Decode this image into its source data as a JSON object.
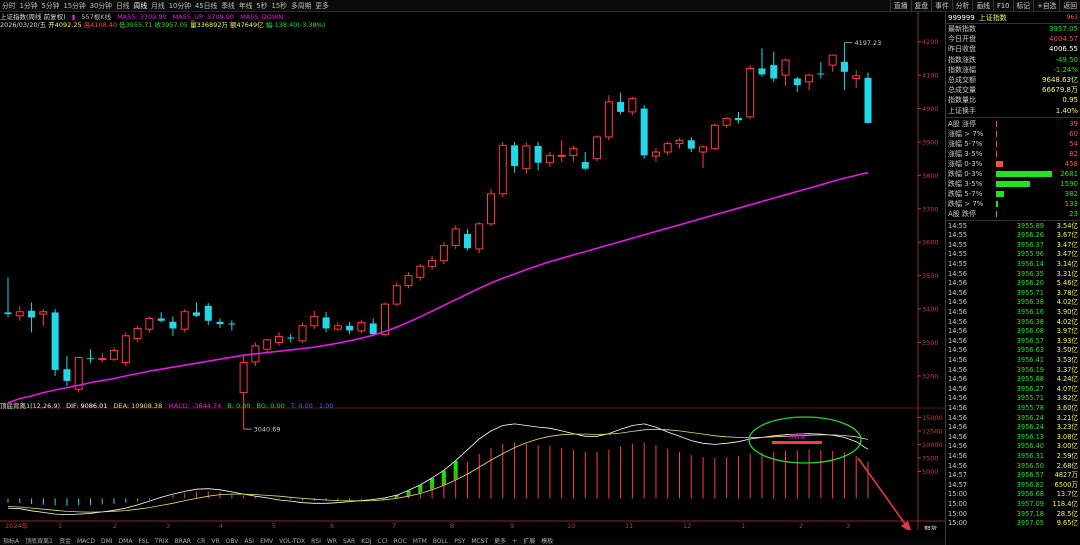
{
  "top_bar": {
    "periods": [
      "分时",
      "1分钟",
      "5分钟",
      "15分钟",
      "30分钟",
      "日线",
      "周线",
      "月线",
      "10分钟",
      "45日线",
      "季线",
      "年线",
      "5秒",
      "15秒",
      "多周期",
      "更多"
    ],
    "active_period": 6,
    "tools": [
      "直播",
      "复盘",
      "事件",
      "分析",
      "画线",
      "F10",
      "标记",
      "+自选",
      "返回"
    ]
  },
  "info_line": {
    "title": "上证指数(周线 前复权)",
    "cnt_icon": "▮",
    "count": "557根K线",
    "ma5": "MA55: 3709.90",
    "ma5_up": "MA55_UP: 3709.90",
    "ma5_down": "MA55_DOWN: -"
  },
  "bar_info": {
    "date": "2026/03/20/五",
    "open": "开4092.25",
    "high": "高4108.40",
    "low": "低3955.71",
    "close": "收3957.05",
    "vol": "量336892万",
    "amount": "额47649亿",
    "change": "幅-138.40(-3.38%)"
  },
  "indicator_line": {
    "name": "顶底背离1(12,26,9)",
    "dif": "DIF: 9086.01",
    "dea": "DEA: 10908.38",
    "macd": "MACD: -3644.74",
    "b": "B: 0.00",
    "bg": "BG: 0.00",
    "t": "T: 0.00",
    "extra": "1.00"
  },
  "bottom_tabs": [
    "指标A",
    "顶底背离1",
    "资金",
    "MACD",
    "DMI",
    "DMA",
    "FSL",
    "TRIX",
    "BRAR",
    "CR",
    "VR",
    "OBV",
    "ASI",
    "EMV",
    "VOL-TDX",
    "RSI",
    "WR",
    "SAR",
    "KDJ",
    "CCI",
    "ROC",
    "MTM",
    "BOLL",
    "PSY",
    "MCST",
    "更多",
    "+",
    "扩展",
    "模板"
  ],
  "colors": {
    "up": "#ff3b3b",
    "down": "#22d8e6",
    "ma": "#e21ae2",
    "dif": "#ffffff",
    "dea": "#e8e06a",
    "hist_green": "#00f000",
    "hist_red": "#ff3b3b",
    "axis": "#c04040",
    "label_pos": "#ff4a4a",
    "label_neg": "#23e123",
    "yellow": "#f5f561"
  },
  "chart_data": {
    "type": "candlestick",
    "price_axis": {
      "ticks": [
        3200,
        3300,
        3400,
        3500,
        3600,
        3700,
        3800,
        3900,
        4000,
        4100,
        4200
      ],
      "range": [
        3110,
        4265
      ]
    },
    "indicator_axis": {
      "ticks": [
        5000,
        7500,
        10000,
        12500,
        15000
      ],
      "range": [
        -4000,
        16000
      ]
    },
    "x_labels": [
      "2024年",
      "1",
      "2",
      "3",
      "4",
      "5",
      "6",
      "7",
      "8",
      "9",
      "10",
      "11",
      "12",
      "1",
      "2",
      "3"
    ],
    "candles": [
      {
        "o": 3390,
        "h": 3495,
        "l": 3375,
        "c": 3385
      },
      {
        "o": 3380,
        "h": 3410,
        "l": 3365,
        "c": 3392
      },
      {
        "o": 3395,
        "h": 3420,
        "l": 3330,
        "c": 3375
      },
      {
        "o": 3385,
        "h": 3400,
        "l": 3350,
        "c": 3392
      },
      {
        "o": 3390,
        "h": 3400,
        "l": 3200,
        "c": 3218
      },
      {
        "o": 3220,
        "h": 3260,
        "l": 3170,
        "c": 3185
      },
      {
        "o": 3160,
        "h": 3255,
        "l": 3150,
        "c": 3255
      },
      {
        "o": 3253,
        "h": 3280,
        "l": 3238,
        "c": 3250
      },
      {
        "o": 3252,
        "h": 3268,
        "l": 3240,
        "c": 3252
      },
      {
        "o": 3250,
        "h": 3285,
        "l": 3244,
        "c": 3276
      },
      {
        "o": 3240,
        "h": 3330,
        "l": 3228,
        "c": 3320
      },
      {
        "o": 3312,
        "h": 3350,
        "l": 3300,
        "c": 3342
      },
      {
        "o": 3340,
        "h": 3378,
        "l": 3330,
        "c": 3372
      },
      {
        "o": 3372,
        "h": 3390,
        "l": 3360,
        "c": 3365
      },
      {
        "o": 3362,
        "h": 3378,
        "l": 3320,
        "c": 3342
      },
      {
        "o": 3340,
        "h": 3400,
        "l": 3330,
        "c": 3392
      },
      {
        "o": 3390,
        "h": 3420,
        "l": 3376,
        "c": 3380
      },
      {
        "o": 3410,
        "h": 3418,
        "l": 3352,
        "c": 3365
      },
      {
        "o": 3362,
        "h": 3372,
        "l": 3344,
        "c": 3355
      },
      {
        "o": 3357,
        "h": 3366,
        "l": 3335,
        "c": 3354
      },
      {
        "o": 3150,
        "h": 3260,
        "l": 3041,
        "c": 3240
      },
      {
        "o": 3242,
        "h": 3300,
        "l": 3230,
        "c": 3290
      },
      {
        "o": 3280,
        "h": 3310,
        "l": 3268,
        "c": 3308
      },
      {
        "o": 3300,
        "h": 3330,
        "l": 3290,
        "c": 3318
      },
      {
        "o": 3315,
        "h": 3325,
        "l": 3300,
        "c": 3312
      },
      {
        "o": 3305,
        "h": 3360,
        "l": 3298,
        "c": 3350
      },
      {
        "o": 3350,
        "h": 3395,
        "l": 3340,
        "c": 3378
      },
      {
        "o": 3375,
        "h": 3392,
        "l": 3330,
        "c": 3342
      },
      {
        "o": 3340,
        "h": 3360,
        "l": 3335,
        "c": 3350
      },
      {
        "o": 3350,
        "h": 3362,
        "l": 3325,
        "c": 3336
      },
      {
        "o": 3335,
        "h": 3368,
        "l": 3328,
        "c": 3360
      },
      {
        "o": 3357,
        "h": 3372,
        "l": 3318,
        "c": 3325
      },
      {
        "o": 3324,
        "h": 3420,
        "l": 3318,
        "c": 3415
      },
      {
        "o": 3415,
        "h": 3480,
        "l": 3408,
        "c": 3470
      },
      {
        "o": 3470,
        "h": 3510,
        "l": 3462,
        "c": 3500
      },
      {
        "o": 3495,
        "h": 3535,
        "l": 3485,
        "c": 3528
      },
      {
        "o": 3528,
        "h": 3560,
        "l": 3518,
        "c": 3545
      },
      {
        "o": 3545,
        "h": 3600,
        "l": 3535,
        "c": 3590
      },
      {
        "o": 3590,
        "h": 3650,
        "l": 3580,
        "c": 3640
      },
      {
        "o": 3625,
        "h": 3640,
        "l": 3575,
        "c": 3582
      },
      {
        "o": 3580,
        "h": 3660,
        "l": 3568,
        "c": 3655
      },
      {
        "o": 3655,
        "h": 3760,
        "l": 3648,
        "c": 3745
      },
      {
        "o": 3745,
        "h": 3900,
        "l": 3735,
        "c": 3890
      },
      {
        "o": 3890,
        "h": 3900,
        "l": 3808,
        "c": 3828
      },
      {
        "o": 3820,
        "h": 3898,
        "l": 3805,
        "c": 3888
      },
      {
        "o": 3888,
        "h": 3900,
        "l": 3815,
        "c": 3838
      },
      {
        "o": 3838,
        "h": 3870,
        "l": 3825,
        "c": 3860
      },
      {
        "o": 3858,
        "h": 3905,
        "l": 3840,
        "c": 3860
      },
      {
        "o": 3860,
        "h": 3888,
        "l": 3842,
        "c": 3880
      },
      {
        "o": 3840,
        "h": 3870,
        "l": 3815,
        "c": 3820
      },
      {
        "o": 3850,
        "h": 3920,
        "l": 3842,
        "c": 3915
      },
      {
        "o": 3915,
        "h": 4040,
        "l": 3905,
        "c": 4020
      },
      {
        "o": 4020,
        "h": 4048,
        "l": 3982,
        "c": 3990
      },
      {
        "o": 3990,
        "h": 4035,
        "l": 3980,
        "c": 4030
      },
      {
        "o": 4000,
        "h": 4010,
        "l": 3850,
        "c": 3860
      },
      {
        "o": 3858,
        "h": 3882,
        "l": 3840,
        "c": 3870
      },
      {
        "o": 3870,
        "h": 3902,
        "l": 3860,
        "c": 3895
      },
      {
        "o": 3895,
        "h": 3912,
        "l": 3880,
        "c": 3905
      },
      {
        "o": 3905,
        "h": 3915,
        "l": 3870,
        "c": 3880
      },
      {
        "o": 3870,
        "h": 3890,
        "l": 3822,
        "c": 3885
      },
      {
        "o": 3880,
        "h": 3955,
        "l": 3875,
        "c": 3950
      },
      {
        "o": 3950,
        "h": 3975,
        "l": 3942,
        "c": 3970
      },
      {
        "o": 3972,
        "h": 3990,
        "l": 3955,
        "c": 3965
      },
      {
        "o": 3975,
        "h": 4130,
        "l": 3968,
        "c": 4120
      },
      {
        "o": 4120,
        "h": 4180,
        "l": 4095,
        "c": 4102
      },
      {
        "o": 4130,
        "h": 4170,
        "l": 4080,
        "c": 4090
      },
      {
        "o": 4100,
        "h": 4150,
        "l": 4068,
        "c": 4145
      },
      {
        "o": 4090,
        "h": 4095,
        "l": 4050,
        "c": 4070
      },
      {
        "o": 4080,
        "h": 4105,
        "l": 4055,
        "c": 4100
      },
      {
        "o": 4105,
        "h": 4140,
        "l": 4090,
        "c": 4102
      },
      {
        "o": 4130,
        "h": 4162,
        "l": 4110,
        "c": 4160
      },
      {
        "o": 4140,
        "h": 4197,
        "l": 4055,
        "c": 4110
      },
      {
        "o": 4090,
        "h": 4115,
        "l": 4062,
        "c": 4098
      },
      {
        "o": 4092,
        "h": 4108,
        "l": 3955,
        "c": 3957
      }
    ],
    "ma55": [
      3120,
      3132,
      3140,
      3150,
      3158,
      3165,
      3172,
      3180,
      3186,
      3192,
      3200,
      3207,
      3214,
      3220,
      3226,
      3232,
      3238,
      3244,
      3250,
      3256,
      3262,
      3266,
      3270,
      3274,
      3278,
      3282,
      3286,
      3292,
      3298,
      3305,
      3313,
      3322,
      3333,
      3346,
      3361,
      3377,
      3394,
      3411,
      3428,
      3445,
      3462,
      3478,
      3492,
      3505,
      3518,
      3530,
      3542,
      3552,
      3562,
      3572,
      3582,
      3592,
      3602,
      3612,
      3622,
      3632,
      3642,
      3652,
      3662,
      3672,
      3682,
      3692,
      3702,
      3712,
      3722,
      3732,
      3742,
      3752,
      3762,
      3772,
      3782,
      3792,
      3800,
      3808
    ],
    "dif": [
      -1800,
      -1900,
      -2300,
      -2600,
      -2900,
      -3000,
      -2900,
      -2800,
      -2500,
      -2200,
      -1800,
      -1200,
      -500,
      200,
      800,
      1300,
      1700,
      1800,
      1600,
      1200,
      800,
      400,
      100,
      -300,
      -500,
      -800,
      -900,
      -900,
      -800,
      -600,
      -400,
      -200,
      100,
      600,
      1500,
      2500,
      3800,
      5200,
      7000,
      9000,
      11000,
      12500,
      13500,
      13800,
      13500,
      13200,
      13000,
      12500,
      12000,
      11500,
      11500,
      12000,
      12800,
      13500,
      13800,
      13200,
      12300,
      11500,
      10700,
      10200,
      10000,
      10200,
      10500,
      11000,
      11300,
      11600,
      11800,
      11900,
      12000,
      11900,
      11700,
      11300,
      10500,
      9100
    ],
    "dea": [
      -1500,
      -1600,
      -1800,
      -2000,
      -2200,
      -2400,
      -2500,
      -2550,
      -2500,
      -2400,
      -2250,
      -2000,
      -1700,
      -1300,
      -900,
      -400,
      0,
      400,
      700,
      800,
      800,
      700,
      550,
      400,
      200,
      0,
      -150,
      -300,
      -400,
      -450,
      -450,
      -400,
      -250,
      0,
      400,
      900,
      1600,
      2400,
      3400,
      4500,
      5800,
      7100,
      8300,
      9400,
      10300,
      11000,
      11500,
      11800,
      11900,
      11900,
      11850,
      11900,
      12100,
      12400,
      12700,
      12800,
      12700,
      12500,
      12200,
      11900,
      11600,
      11400,
      11300,
      11300,
      11300,
      11400,
      11500,
      11600,
      11700,
      11750,
      11750,
      11650,
      11400,
      10900
    ],
    "annotations": {
      "high_label": "4197.23",
      "low_label": "3040.69",
      "ellipse_text": "顶背离"
    }
  },
  "quote": {
    "code": "999999",
    "name": "上证指数",
    "tag": "963",
    "rows": [
      {
        "label": "最新指数",
        "value": "3957.05",
        "color": "#23e123"
      },
      {
        "label": "今日开盘",
        "value": "4004.57",
        "color": "#ff4a4a"
      },
      {
        "label": "昨日收盘",
        "value": "4006.55",
        "color": "#ffffff"
      },
      {
        "label": "指数涨跌",
        "value": "-49.50",
        "color": "#23e123"
      },
      {
        "label": "指数涨幅",
        "value": "-1.24%",
        "color": "#23e123"
      },
      {
        "label": "总成交额",
        "value": "9648.63亿",
        "color": "#f5f561"
      },
      {
        "label": "总成交量",
        "value": "66679.8万",
        "color": "#f5f561"
      },
      {
        "label": "指数量比",
        "value": "0.95",
        "color": "#f5f561"
      },
      {
        "label": "上证换手",
        "value": "1.40%",
        "color": "#f5f561"
      }
    ],
    "dist": [
      {
        "label": "A股 涨停",
        "count": "39",
        "color": "#ff4a4a",
        "pct": 0
      },
      {
        "label": "涨幅 > 7%",
        "count": "60",
        "color": "#ff4a4a",
        "pct": 1
      },
      {
        "label": "涨幅 5-7%",
        "count": "54",
        "color": "#ff4a4a",
        "pct": 1
      },
      {
        "label": "涨幅 3-5%",
        "count": "82",
        "color": "#ff4a4a",
        "pct": 2
      },
      {
        "label": "涨幅 0-3%",
        "count": "458",
        "color": "#ff4a4a",
        "pct": 12
      },
      {
        "label": "跌幅 0-3%",
        "count": "2681",
        "color": "#23e123",
        "pct": 100
      },
      {
        "label": "跌幅 3-5%",
        "count": "1590",
        "color": "#23e123",
        "pct": 60
      },
      {
        "label": "跌幅 5-7%",
        "count": "382",
        "color": "#23e123",
        "pct": 14
      },
      {
        "label": "跌幅 > 7%",
        "count": "133",
        "color": "#23e123",
        "pct": 4
      },
      {
        "label": "A股 跌停",
        "count": "23",
        "color": "#23e123",
        "pct": 0
      }
    ],
    "ticks": [
      {
        "t": "14:55",
        "p": "3955.89",
        "a": "3.54亿"
      },
      {
        "t": "14:55",
        "p": "3956.26",
        "a": "3.67亿"
      },
      {
        "t": "14:55",
        "p": "3956.37",
        "a": "3.47亿"
      },
      {
        "t": "14:55",
        "p": "3955.96",
        "a": "3.47亿"
      },
      {
        "t": "14:55",
        "p": "3956.14",
        "a": "3.14亿"
      },
      {
        "t": "14:56",
        "p": "3956.35",
        "a": "3.31亿"
      },
      {
        "t": "14:56",
        "p": "3956.20",
        "a": "5.46亿"
      },
      {
        "t": "14:56",
        "p": "3955.71",
        "a": "3.78亿"
      },
      {
        "t": "14:56",
        "p": "3956.38",
        "a": "4.02亿"
      },
      {
        "t": "14:56",
        "p": "3956.16",
        "a": "3.90亿"
      },
      {
        "t": "14:56",
        "p": "3956.38",
        "a": "4.02亿"
      },
      {
        "t": "14:56",
        "p": "3956.08",
        "a": "3.97亿"
      },
      {
        "t": "14:56",
        "p": "3956.57",
        "a": "3.93亿"
      },
      {
        "t": "14:56",
        "p": "3956.63",
        "a": "3.50亿"
      },
      {
        "t": "14:56",
        "p": "3956.41",
        "a": "3.53亿"
      },
      {
        "t": "14:56",
        "p": "3956.19",
        "a": "3.37亿"
      },
      {
        "t": "14:56",
        "p": "3955.88",
        "a": "4.24亿"
      },
      {
        "t": "14:56",
        "p": "3956.27",
        "a": "4.07亿"
      },
      {
        "t": "14:56",
        "p": "3955.71",
        "a": "3.82亿"
      },
      {
        "t": "14:56",
        "p": "3955.78",
        "a": "3.60亿"
      },
      {
        "t": "14:56",
        "p": "3956.24",
        "a": "3.21亿"
      },
      {
        "t": "14:56",
        "p": "3956.24",
        "a": "3.23亿"
      },
      {
        "t": "14:56",
        "p": "3956.13",
        "a": "3.08亿"
      },
      {
        "t": "14:56",
        "p": "3956.40",
        "a": "3.00亿"
      },
      {
        "t": "14:56",
        "p": "3956.31",
        "a": "2.59亿"
      },
      {
        "t": "14:56",
        "p": "3956.50",
        "a": "2.68亿"
      },
      {
        "t": "14:57",
        "p": "3956.57",
        "a": "4827万"
      },
      {
        "t": "14:57",
        "p": "3956.82",
        "a": "6500万"
      },
      {
        "t": "15:00",
        "p": "3956.68",
        "a": "13.7亿"
      },
      {
        "t": "15:00",
        "p": "3957.09",
        "a": "118.4亿"
      },
      {
        "t": "15:00",
        "p": "3957.18",
        "a": "28.5亿"
      },
      {
        "t": "15:00",
        "p": "3957.05",
        "a": "9.65亿"
      }
    ]
  },
  "arrow_label": "期货"
}
